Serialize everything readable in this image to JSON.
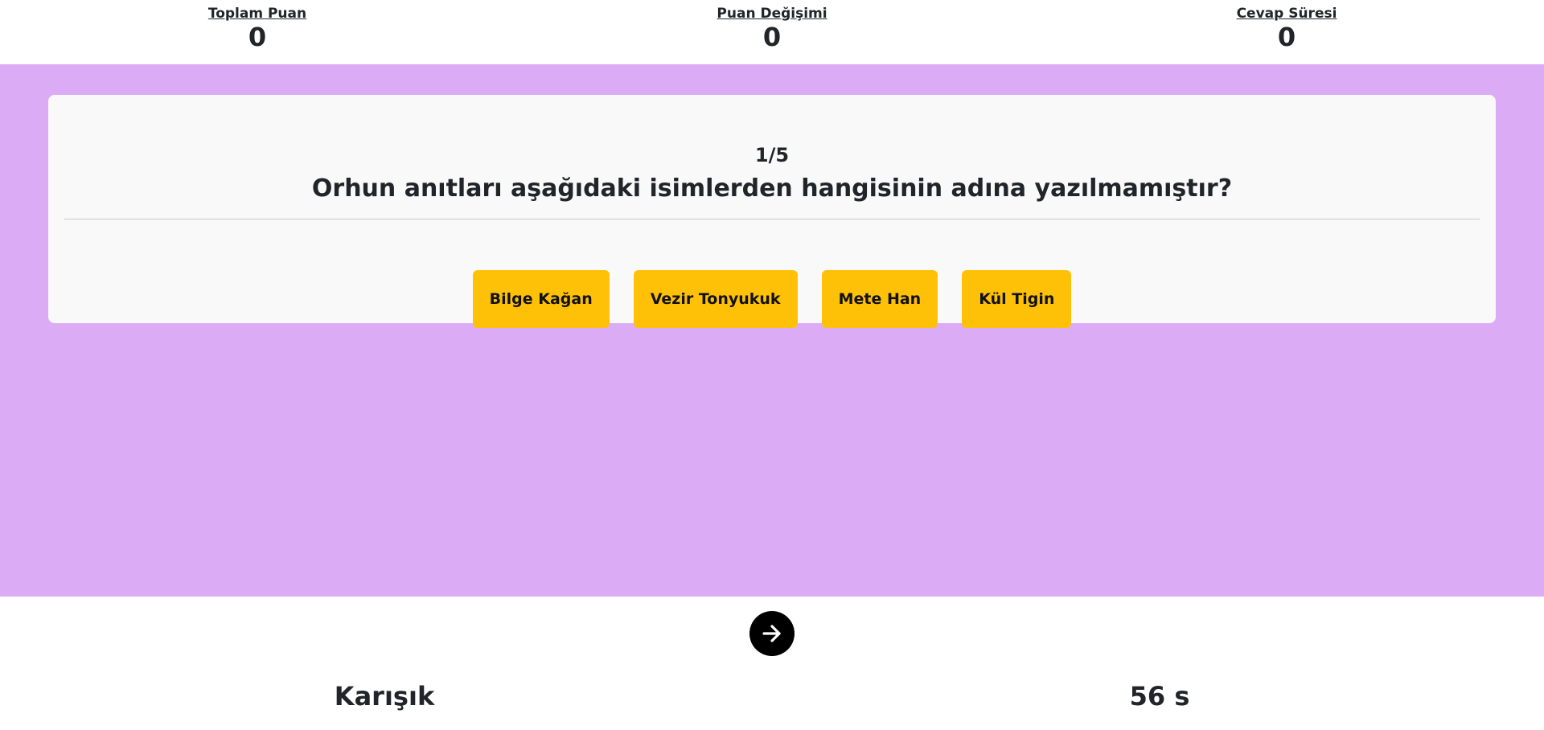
{
  "stats": {
    "total_score": {
      "label": "Toplam Puan",
      "value": "0"
    },
    "score_change": {
      "label": "Puan Değişimi",
      "value": "0"
    },
    "answer_time": {
      "label": "Cevap Süresi",
      "value": "0"
    }
  },
  "question": {
    "counter": "1/5",
    "text": "Orhun anıtları aşağıdaki isimlerden hangisinin adına yazılmamıştır?",
    "options": [
      "Bilge Kağan",
      "Vezir Tonyukuk",
      "Mete Han",
      "Kül Tigin"
    ]
  },
  "next_button": {
    "icon": "arrow-right-icon"
  },
  "footer": {
    "category": "Karışık",
    "timer": "56 s"
  },
  "colors": {
    "background_area": "#dbabf5",
    "card": "#f9f9f9",
    "option": "#ffc107",
    "next_button": "#000000"
  }
}
